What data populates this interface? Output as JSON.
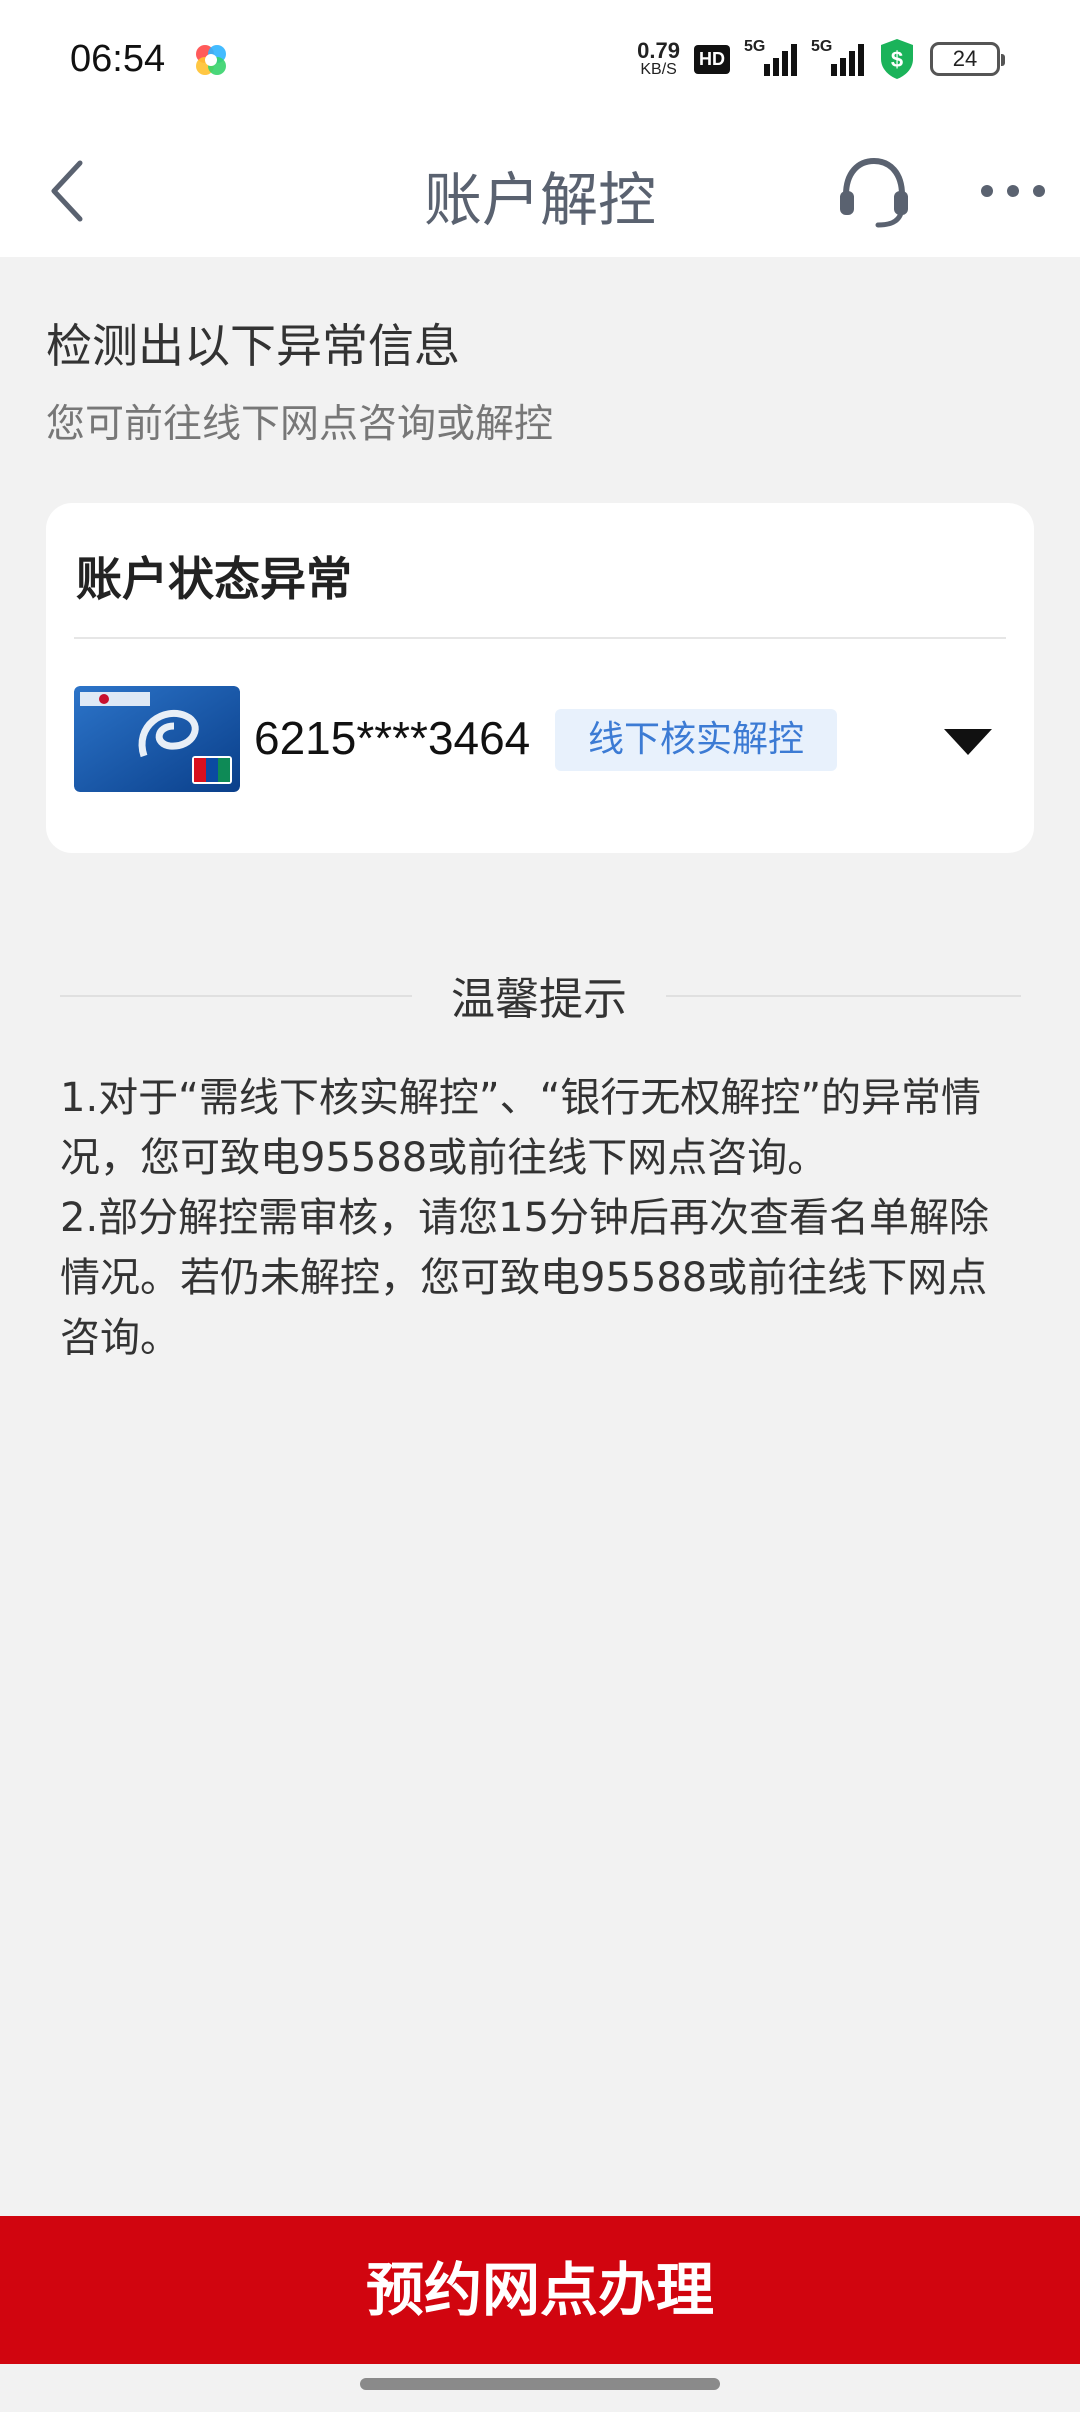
{
  "status_bar": {
    "time": "06:54",
    "net_speed_value": "0.79",
    "net_speed_unit": "KB/S",
    "hd_label": "HD",
    "sim1_label": "5G",
    "sim2_label": "5G",
    "battery": "24"
  },
  "nav": {
    "title": "账户解控",
    "back_icon": "chevron-left-icon",
    "service_icon": "headset-icon",
    "more_icon": "more-horizontal-icon"
  },
  "intro": {
    "title": "检测出以下异常信息",
    "subtitle": "您可前往线下网点咨询或解控"
  },
  "account_card": {
    "title": "账户状态异常",
    "card_number": "6215****3464",
    "status_tag": "线下核实解控",
    "expand_icon": "triangle-down-icon"
  },
  "tips": {
    "title": "温馨提示",
    "items": [
      "1.对于“需线下核实解控”、“银行无权解控”的异常情况，您可致电95588或前往线下网点咨询。",
      "2.部分解控需审核，请您15分钟后再次查看名单解除情况。若仍未解控，您可致电95588或前往线下网点咨询。"
    ]
  },
  "bottom_button": {
    "label": "预约网点办理"
  },
  "colors": {
    "accent_red": "#d1050f",
    "tag_blue": "#3c7bd4",
    "tag_bg": "#e8f1fc",
    "shield_green": "#1bb35a"
  }
}
